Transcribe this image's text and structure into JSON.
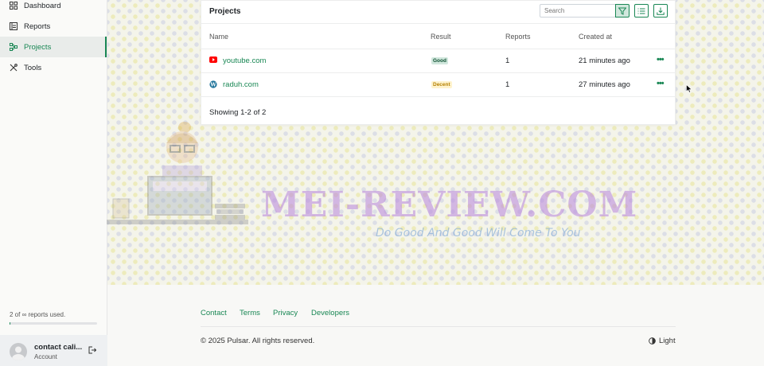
{
  "sidebar": {
    "items": [
      {
        "label": "Dashboard",
        "icon": "grid-icon"
      },
      {
        "label": "Reports",
        "icon": "report-icon"
      },
      {
        "label": "Projects",
        "icon": "projects-icon",
        "active": true
      },
      {
        "label": "Tools",
        "icon": "tools-icon"
      }
    ],
    "usage_text": "2 of ∞ reports used.",
    "usage_fraction": 0.01,
    "account": {
      "name": "contact cali...",
      "subtitle": "Account"
    }
  },
  "card": {
    "title": "Projects",
    "search_placeholder": "Search",
    "columns": [
      "Name",
      "Result",
      "Reports",
      "Created at"
    ],
    "rows": [
      {
        "name": "youtube.com",
        "icon": "youtube-icon",
        "result": "Good",
        "reports": "1",
        "created": "21 minutes ago"
      },
      {
        "name": "raduh.com",
        "icon": "wordpress-icon",
        "result": "Decent",
        "reports": "1",
        "created": "27 minutes ago"
      }
    ],
    "showing": "Showing 1-2 of 2"
  },
  "watermark": {
    "title": "MEI-REVIEW.COM",
    "tagline": "Do Good And Good Will Come To You"
  },
  "footer": {
    "links": [
      "Contact",
      "Terms",
      "Privacy",
      "Developers"
    ],
    "copyright": "© 2025 Pulsar. All rights reserved.",
    "theme": "Light"
  },
  "colors": {
    "accent": "#198754",
    "good_bg": "#d1e7dd",
    "decent_bg": "#fff3cd",
    "youtube": "#ff0000",
    "wordpress": "#21759b"
  }
}
